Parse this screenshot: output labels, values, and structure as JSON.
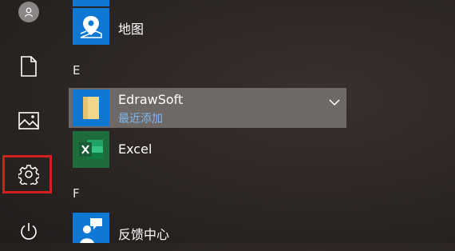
{
  "sections": {
    "e": "E",
    "f": "F"
  },
  "apps": {
    "maps": {
      "label": "地图"
    },
    "edrawsoft": {
      "label": "EdrawSoft",
      "subtitle": "最近添加"
    },
    "excel": {
      "label": "Excel"
    },
    "feedback": {
      "label": "反馈中心"
    }
  },
  "colors": {
    "tile_blue": "#0e78d4",
    "excel_green": "#1e6b3c",
    "highlight_red": "#d31f1f",
    "subtitle_blue": "#7fb8ef"
  },
  "icons": [
    "user-avatar-icon",
    "document-icon",
    "pictures-icon",
    "settings-gear-icon",
    "power-icon",
    "map-pin-icon",
    "folder-icon",
    "excel-icon",
    "feedback-icon",
    "chevron-down-icon"
  ]
}
